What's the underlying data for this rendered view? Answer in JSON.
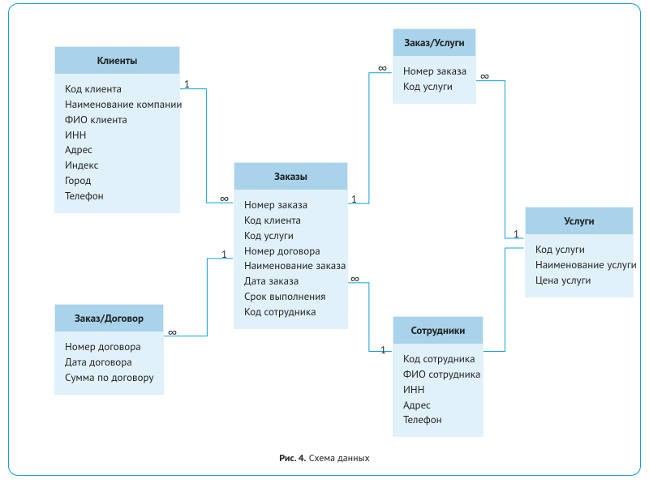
{
  "caption_prefix": "Рис. 4.",
  "caption_text": "Схема данных",
  "tables": {
    "clients": {
      "title": "Клиенты",
      "fields": [
        "Код клиента",
        "Наименование компании",
        "ФИО клиента",
        "ИНН",
        "Адрес",
        "Индекс",
        "Город",
        "Телефон"
      ]
    },
    "order_contract": {
      "title": "Заказ/Договор",
      "fields": [
        "Номер договора",
        "Дата договора",
        "Сумма по договору"
      ]
    },
    "orders": {
      "title": "Заказы",
      "fields": [
        "Номер заказа",
        "Код клиента",
        "Код услуги",
        "Номер договора",
        "Наименование заказа",
        "Дата заказа",
        "Срок выполнения",
        "Код сотрудника"
      ]
    },
    "order_services": {
      "title": "Заказ/Услуги",
      "fields": [
        "Номер заказа",
        "Код услуги"
      ]
    },
    "employees": {
      "title": "Сотрудники",
      "fields": [
        "Код сотрудника",
        "ФИО сотрудника",
        "ИНН",
        "Адрес",
        "Телефон"
      ]
    },
    "services": {
      "title": "Услуги",
      "fields": [
        "Код услуги",
        "Наименование услуги",
        "Цена услуги"
      ]
    }
  },
  "cardinality": {
    "one": "1",
    "many": "∞"
  },
  "relations": [
    {
      "from": "clients",
      "to": "orders",
      "from_card": "1",
      "to_card": "∞"
    },
    {
      "from": "order_contract",
      "to": "orders",
      "from_card": "∞",
      "to_card": "1"
    },
    {
      "from": "orders",
      "to": "order_services",
      "from_card": "1",
      "to_card": "∞"
    },
    {
      "from": "orders",
      "to": "employees",
      "from_card": "∞",
      "to_card": "1"
    },
    {
      "from": "order_services",
      "to": "services",
      "from_card": "∞",
      "to_card": "1"
    },
    {
      "from": "employees",
      "to": "services",
      "from_card": "∞",
      "to_card": "1"
    }
  ]
}
